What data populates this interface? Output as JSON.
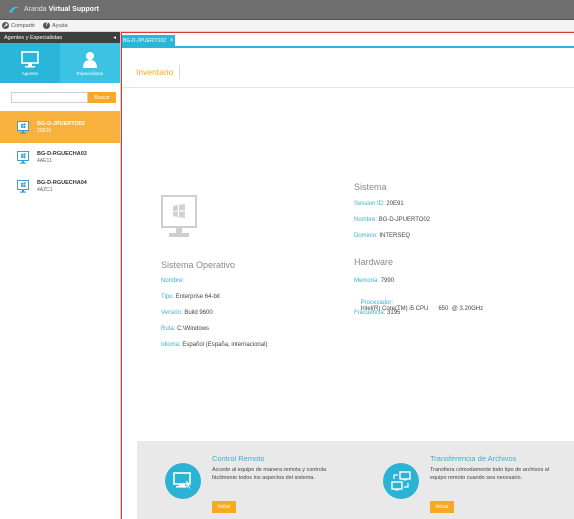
{
  "titlebar": {
    "brand": "Aranda",
    "product": "Virtual Support"
  },
  "menu": [
    {
      "label": "Compartir",
      "icon": "share-icon"
    },
    {
      "label": "Ayuda",
      "icon": "help-icon"
    }
  ],
  "sidebar": {
    "header": "Agentes y Especialistas",
    "collapse": "◂",
    "tabs": [
      {
        "label": "Agentes",
        "icon": "monitor-icon"
      },
      {
        "label": "Especialistas",
        "icon": "user-icon"
      }
    ],
    "search": {
      "placeholder": "",
      "button": "Buscar"
    },
    "agents": [
      {
        "name": "BG-D-JPUERTO02",
        "code": "20E91",
        "selected": true
      },
      {
        "name": "BG-D-RGUECHA03",
        "code": "4AE11",
        "selected": false
      },
      {
        "name": "BG-D-RGUECHA04",
        "code": "4AZC1",
        "selected": false
      }
    ]
  },
  "doc_tab": {
    "label": "BG-D-JPUERTO02",
    "close": "×"
  },
  "content": {
    "tab": "Inventario",
    "sistema": {
      "title": "Sistema",
      "rows": [
        {
          "k": "Session ID:",
          "v": "20E91"
        },
        {
          "k": "Nombre:",
          "v": "BG-D-JPUERTO02"
        },
        {
          "k": "Dominio:",
          "v": "INTERSEQ"
        }
      ]
    },
    "hardware": {
      "title": "Hardware",
      "rows": [
        {
          "k": "Memoria:",
          "v": "7990"
        },
        {
          "k": "Procesador:",
          "v": "Intel(R) Core(TM) i5 CPU      650  @ 3.20GHz"
        },
        {
          "k": "Frecuencia:",
          "v": "3195"
        }
      ]
    },
    "so": {
      "title": "Sistema Operativo",
      "rows": [
        {
          "k": "Nombre:",
          "v": ""
        },
        {
          "k": "Tipo:",
          "v": "Enterprise 64-bit"
        },
        {
          "k": "Versión:",
          "v": "Build 9600"
        },
        {
          "k": "Ruta:",
          "v": "C:\\Windows"
        },
        {
          "k": "Idioma:",
          "v": "Español (España, internacional)"
        }
      ]
    }
  },
  "features": [
    {
      "title": "Control Remoto",
      "desc": "Accede al equipo de manera remota y controla fácilmente todos los aspectos del sistema.",
      "button": "Iniciar",
      "icon": "remote-control-icon"
    },
    {
      "title": "Transferencia de Archivos",
      "desc": "Transfiera cómodamente todo tipo de archivos al equipo remoto cuando sea necesario.",
      "button": "Iniciar",
      "icon": "file-transfer-icon"
    }
  ]
}
